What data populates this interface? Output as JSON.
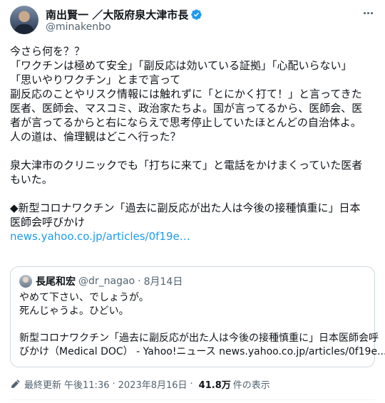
{
  "author": {
    "display_name": "南出賢一 ／大阪府泉大津市長",
    "handle": "@minakenbo",
    "verified": true
  },
  "tweet": {
    "lines": [
      "今さら何を？？",
      "「ワクチンは極めて安全」「副反応は効いている証拠」「心配いらない」",
      "「思いやりワクチン」とまで言って",
      "副反応のことやリスク情報には触れずに「とにかく打て！」と言ってきた",
      "医者、医師会、マスコミ、政治家たちよ。国が言ってるから、医師会、医",
      "者が言ってるからと右にならえで思考停止していたほとんどの自治体よ。",
      "人の道は、倫理観はどこへ行った？",
      "泉大津市のクリニックでも「打ちに来て」と電話をかけまくっていた医者",
      "もいた。",
      "◆新型コロナワクチン「過去に副反応が出た人は今後の接種慎重に」日本",
      "医師会呼びかけ"
    ],
    "link": "news.yahoo.co.jp/articles/0f19e…"
  },
  "quote": {
    "name": "長尾和宏",
    "handle": "@dr_nagao",
    "dot": "·",
    "date": "8月14日",
    "lines": [
      "やめて下さい、でしょうが。",
      "死んじゃうよ。ひどい。",
      "新型コロナワクチン「過去に副反応が出た人は今後の接種慎重に」日本医師会呼",
      "びかけ（Medical DOC） - Yahoo!ニュース news.yahoo.co.jp/articles/0f19e..."
    ]
  },
  "footer": {
    "edited_label": "最終更新",
    "time": "午後11:36",
    "sep1": "·",
    "date": "2023年8月16日",
    "sep2": "·",
    "views": "41.8万",
    "views_label": "件の表示"
  },
  "icons": {
    "verified": "verified-badge-icon",
    "more": "more-icon",
    "edit": "edit-pencil-icon"
  },
  "colors": {
    "accent": "#1d9bf0",
    "text": "#0f1419",
    "secondary": "#536471",
    "border": "#cfd9de"
  }
}
